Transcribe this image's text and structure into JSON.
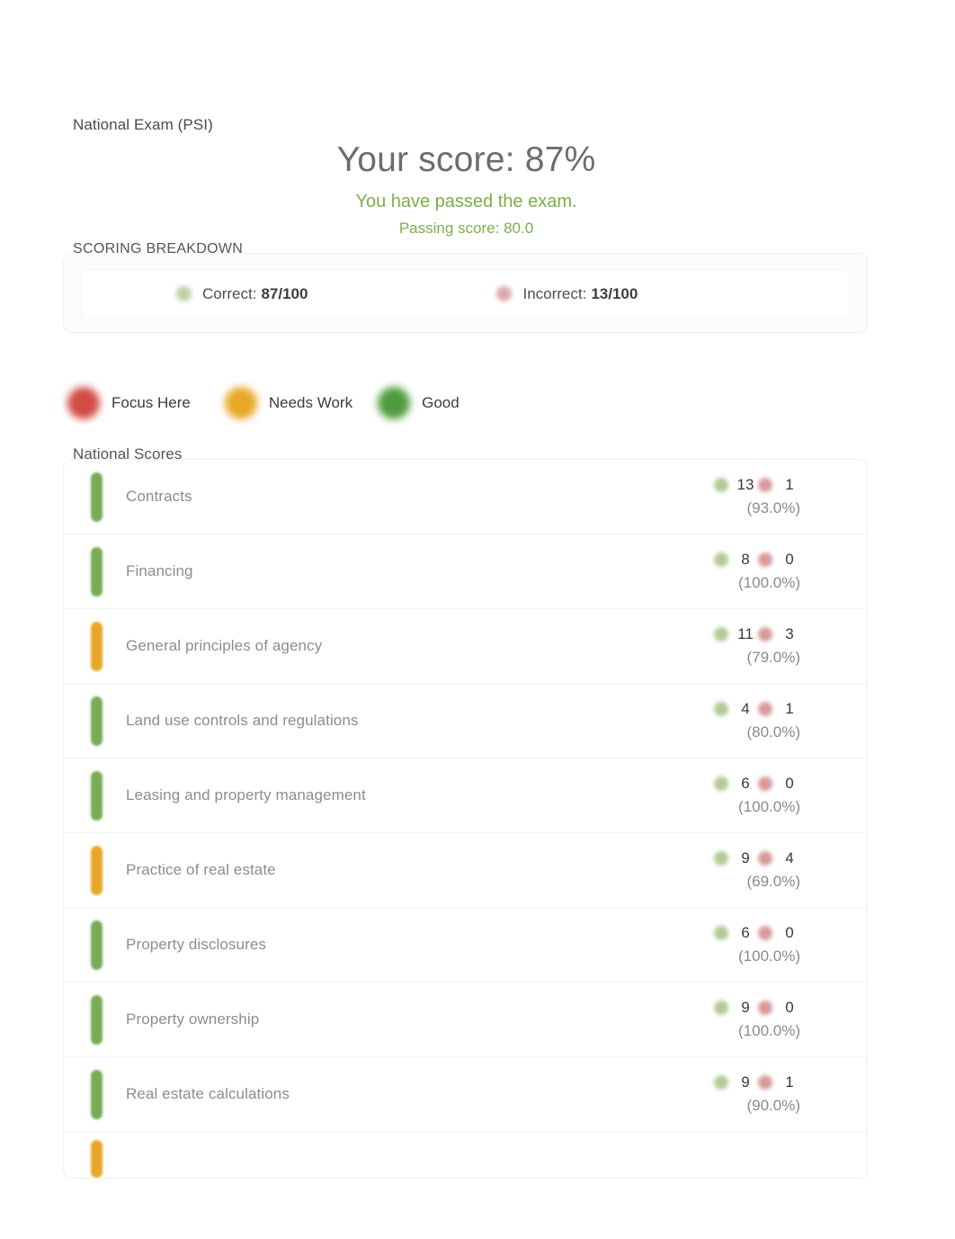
{
  "header": {
    "exam_name": "National Exam (PSI)",
    "score_title": "Your score: 87%",
    "pass_message": "You have passed the exam.",
    "passing_score": "Passing score: 80.0"
  },
  "breakdown": {
    "label": "SCORING BREAKDOWN",
    "correct_label": "Correct:",
    "correct_value": "87/100",
    "incorrect_label": "Incorrect:",
    "incorrect_value": "13/100",
    "correct_icon": "green-circle-icon",
    "incorrect_icon": "red-circle-icon"
  },
  "legend": {
    "items": [
      {
        "label": "Focus Here",
        "color": "#d24b45",
        "key": "focus"
      },
      {
        "label": "Needs Work",
        "color": "#e8a726",
        "key": "needs"
      },
      {
        "label": "Good",
        "color": "#4f9c3d",
        "key": "good"
      }
    ]
  },
  "scores": {
    "label": "National Scores",
    "rows": [
      {
        "topic": "Contracts",
        "correct": "13",
        "incorrect": "1",
        "percent": "(93.0%)",
        "status": "good"
      },
      {
        "topic": "Financing",
        "correct": "8",
        "incorrect": "0",
        "percent": "(100.0%)",
        "status": "good"
      },
      {
        "topic": "General principles of agency",
        "correct": "11",
        "incorrect": "3",
        "percent": "(79.0%)",
        "status": "needs"
      },
      {
        "topic": "Land use controls and regulations",
        "correct": "4",
        "incorrect": "1",
        "percent": "(80.0%)",
        "status": "good"
      },
      {
        "topic": "Leasing and property management",
        "correct": "6",
        "incorrect": "0",
        "percent": "(100.0%)",
        "status": "good"
      },
      {
        "topic": "Practice of real estate",
        "correct": "9",
        "incorrect": "4",
        "percent": "(69.0%)",
        "status": "needs"
      },
      {
        "topic": "Property disclosures",
        "correct": "6",
        "incorrect": "0",
        "percent": "(100.0%)",
        "status": "good"
      },
      {
        "topic": "Property ownership",
        "correct": "9",
        "incorrect": "0",
        "percent": "(100.0%)",
        "status": "good"
      },
      {
        "topic": "Real estate calculations",
        "correct": "9",
        "incorrect": "1",
        "percent": "(90.0%)",
        "status": "good"
      },
      {
        "topic": "",
        "correct": "",
        "incorrect": "",
        "percent": "",
        "status": "needs"
      }
    ]
  },
  "colors": {
    "pass_green": "#7cad4c",
    "good": "#79ab55",
    "needs_work": "#e8a726",
    "focus_here": "#d24b45",
    "heading_gray": "#6d6d6d"
  }
}
